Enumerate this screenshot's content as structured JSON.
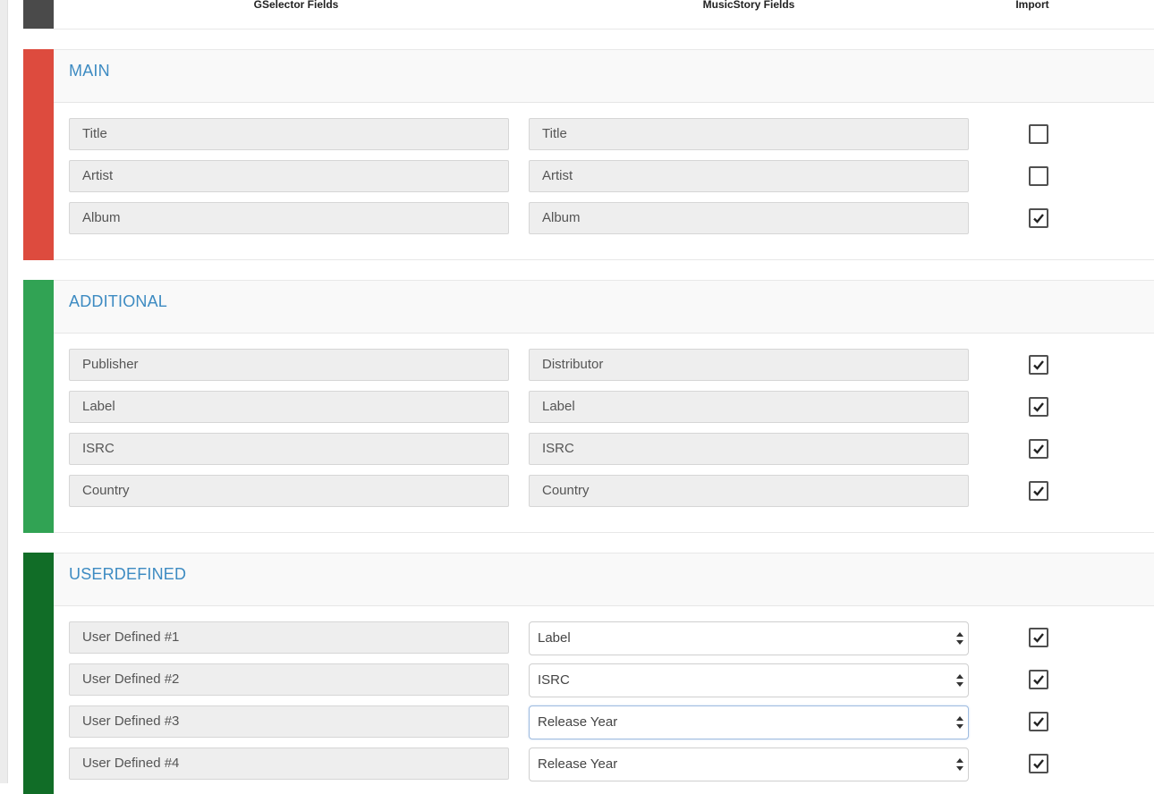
{
  "header": {
    "col_gselector": "GSelector Fields",
    "col_musicstory": "MusicStory Fields",
    "col_import": "Import"
  },
  "colors": {
    "main_bar": "#dd4b3e",
    "additional_bar": "#31a354",
    "userdefined_bar": "#116d27",
    "section_title": "#3d8bc2"
  },
  "sections": [
    {
      "title": "MAIN",
      "rows": [
        {
          "gselector": "Title",
          "musicstory": "Title",
          "import": false
        },
        {
          "gselector": "Artist",
          "musicstory": "Artist",
          "import": false
        },
        {
          "gselector": "Album",
          "musicstory": "Album",
          "import": true
        }
      ]
    },
    {
      "title": "ADDITIONAL",
      "rows": [
        {
          "gselector": "Publisher",
          "musicstory": "Distributor",
          "import": true
        },
        {
          "gselector": "Label",
          "musicstory": "Label",
          "import": true
        },
        {
          "gselector": "ISRC",
          "musicstory": "ISRC",
          "import": true
        },
        {
          "gselector": "Country",
          "musicstory": "Country",
          "import": true
        }
      ]
    },
    {
      "title": "USERDEFINED",
      "rows": [
        {
          "gselector": "User Defined #1",
          "musicstory": "Label",
          "import": true
        },
        {
          "gselector": "User Defined #2",
          "musicstory": "ISRC",
          "import": true
        },
        {
          "gselector": "User Defined #3",
          "musicstory": "Release Year",
          "import": true
        },
        {
          "gselector": "User Defined #4",
          "musicstory": "Release Year",
          "import": true
        }
      ]
    }
  ]
}
